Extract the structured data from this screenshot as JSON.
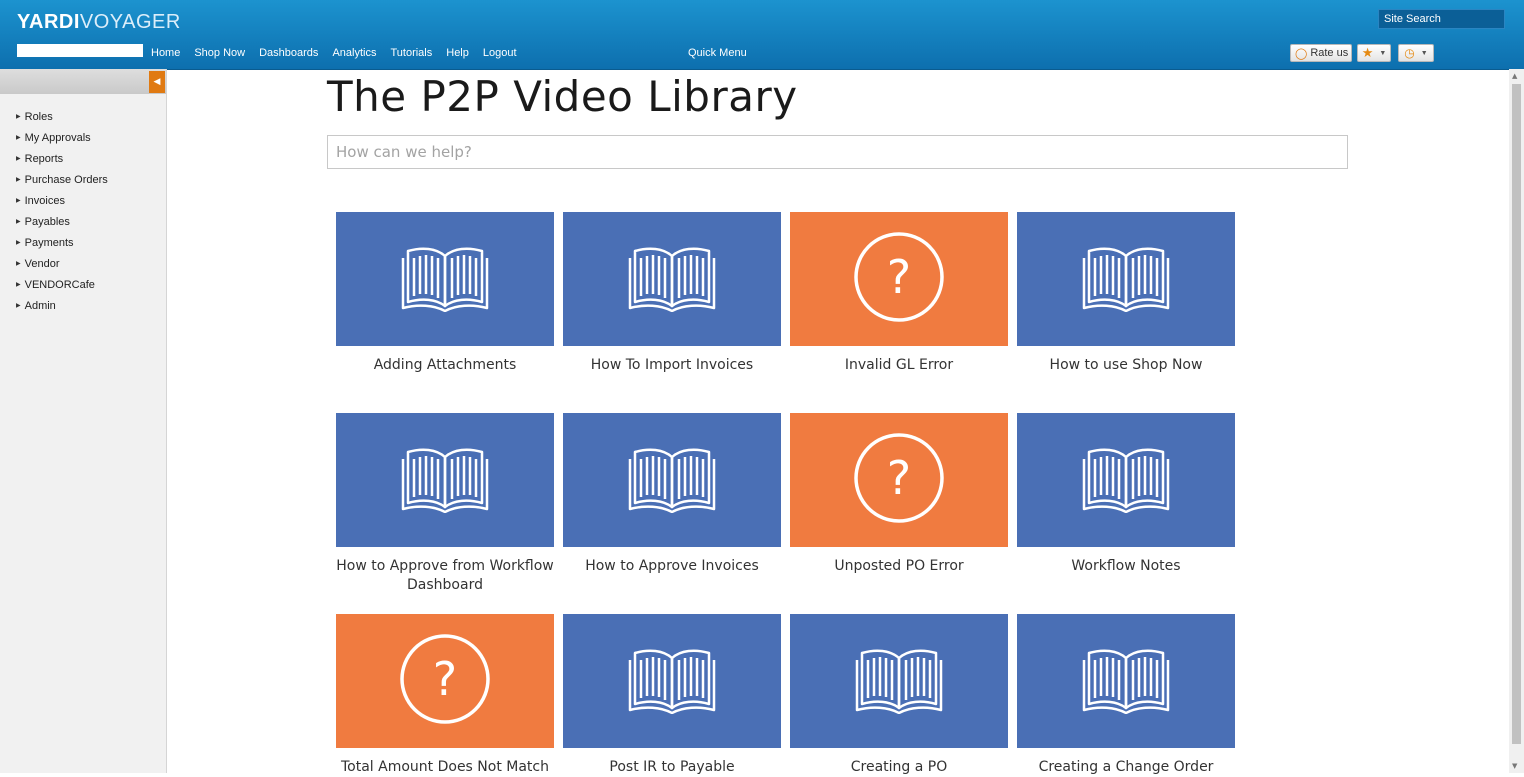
{
  "header": {
    "logo_part1": "YARDI",
    "logo_part2": "VOYAGER",
    "nav": [
      "Home",
      "Shop Now",
      "Dashboards",
      "Analytics",
      "Tutorials",
      "Help",
      "Logout"
    ],
    "quick_menu": "Quick Menu",
    "site_search": "Site Search",
    "rate_us": "Rate us"
  },
  "sidebar": {
    "items": [
      "Roles",
      "My Approvals",
      "Reports",
      "Purchase Orders",
      "Invoices",
      "Payables",
      "Payments",
      "Vendor",
      "VENDORCafe",
      "Admin"
    ]
  },
  "main": {
    "title": "The P2P Video Library",
    "search_placeholder": "How can we help?",
    "cards": [
      {
        "label": "Adding Attachments",
        "icon": "book-icon",
        "color": "#4a6fb5"
      },
      {
        "label": "How To Import Invoices",
        "icon": "book-icon",
        "color": "#4a6fb5"
      },
      {
        "label": "Invalid GL Error",
        "icon": "question-icon",
        "color": "#f07b40"
      },
      {
        "label": "How to use Shop Now",
        "icon": "book-icon",
        "color": "#4a6fb5"
      },
      {
        "label": "How to Approve from Workflow Dashboard",
        "icon": "book-icon",
        "color": "#4a6fb5"
      },
      {
        "label": "How to Approve Invoices",
        "icon": "book-icon",
        "color": "#4a6fb5"
      },
      {
        "label": "Unposted PO Error",
        "icon": "question-icon",
        "color": "#f07b40"
      },
      {
        "label": "Workflow Notes",
        "icon": "book-icon",
        "color": "#4a6fb5"
      },
      {
        "label": "Total Amount Does Not Match",
        "icon": "question-icon",
        "color": "#f07b40"
      },
      {
        "label": "Post IR to Payable",
        "icon": "book-icon",
        "color": "#4a6fb5"
      },
      {
        "label": "Creating a PO",
        "icon": "book-icon",
        "color": "#4a6fb5"
      },
      {
        "label": "Creating a Change Order",
        "icon": "book-icon",
        "color": "#4a6fb5"
      }
    ]
  },
  "colors": {
    "header_blue": "#1c93cf",
    "tile_blue": "#4a6fb5",
    "tile_orange": "#f07b40",
    "accent_orange": "#e07a12"
  }
}
